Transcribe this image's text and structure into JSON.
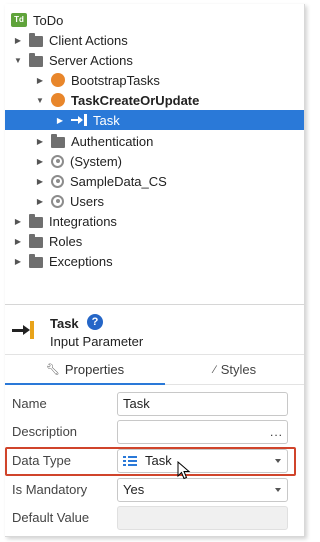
{
  "tree": {
    "root": {
      "badge": "Td",
      "label": "ToDo"
    },
    "items": [
      {
        "label": "Client Actions",
        "icon": "folder-icon",
        "expanded": false
      },
      {
        "label": "Server Actions",
        "icon": "folder-icon",
        "expanded": true
      },
      {
        "label": "BootstrapTasks",
        "icon": "server-action-icon",
        "expanded": false
      },
      {
        "label": "TaskCreateOrUpdate",
        "icon": "server-action-icon",
        "expanded": true
      },
      {
        "label": "Task",
        "icon": "input-parameter-icon",
        "selected": true
      },
      {
        "label": "Authentication",
        "icon": "folder-icon",
        "expanded": false
      },
      {
        "label": "(System)",
        "icon": "module-reference-icon",
        "expanded": false
      },
      {
        "label": "SampleData_CS",
        "icon": "module-reference-icon",
        "expanded": false
      },
      {
        "label": "Users",
        "icon": "module-reference-icon",
        "expanded": false
      },
      {
        "label": "Integrations",
        "icon": "folder-icon",
        "expanded": false
      },
      {
        "label": "Roles",
        "icon": "folder-icon",
        "expanded": false
      },
      {
        "label": "Exceptions",
        "icon": "folder-icon",
        "expanded": false
      }
    ]
  },
  "properties": {
    "element_name": "Task",
    "help_glyph": "?",
    "element_type": "Input Parameter",
    "tabs": [
      {
        "label": "Properties",
        "icon": "wrench-icon",
        "active": true
      },
      {
        "label": "Styles",
        "icon": "brush-icon",
        "active": false
      }
    ],
    "rows": [
      {
        "label": "Name",
        "value": "Task"
      },
      {
        "label": "Description",
        "value": "",
        "button": "..."
      },
      {
        "label": "Data Type",
        "value": "Task",
        "highlighted": true
      },
      {
        "label": "Is Mandatory",
        "value": "Yes"
      },
      {
        "label": "Default Value",
        "value": ""
      }
    ]
  },
  "colors": {
    "selection": "#2a79d8",
    "highlight_border": "#d0442b",
    "server_action": "#e8862b",
    "help_badge": "#2566c7",
    "param_bar": "#e8a31a"
  }
}
